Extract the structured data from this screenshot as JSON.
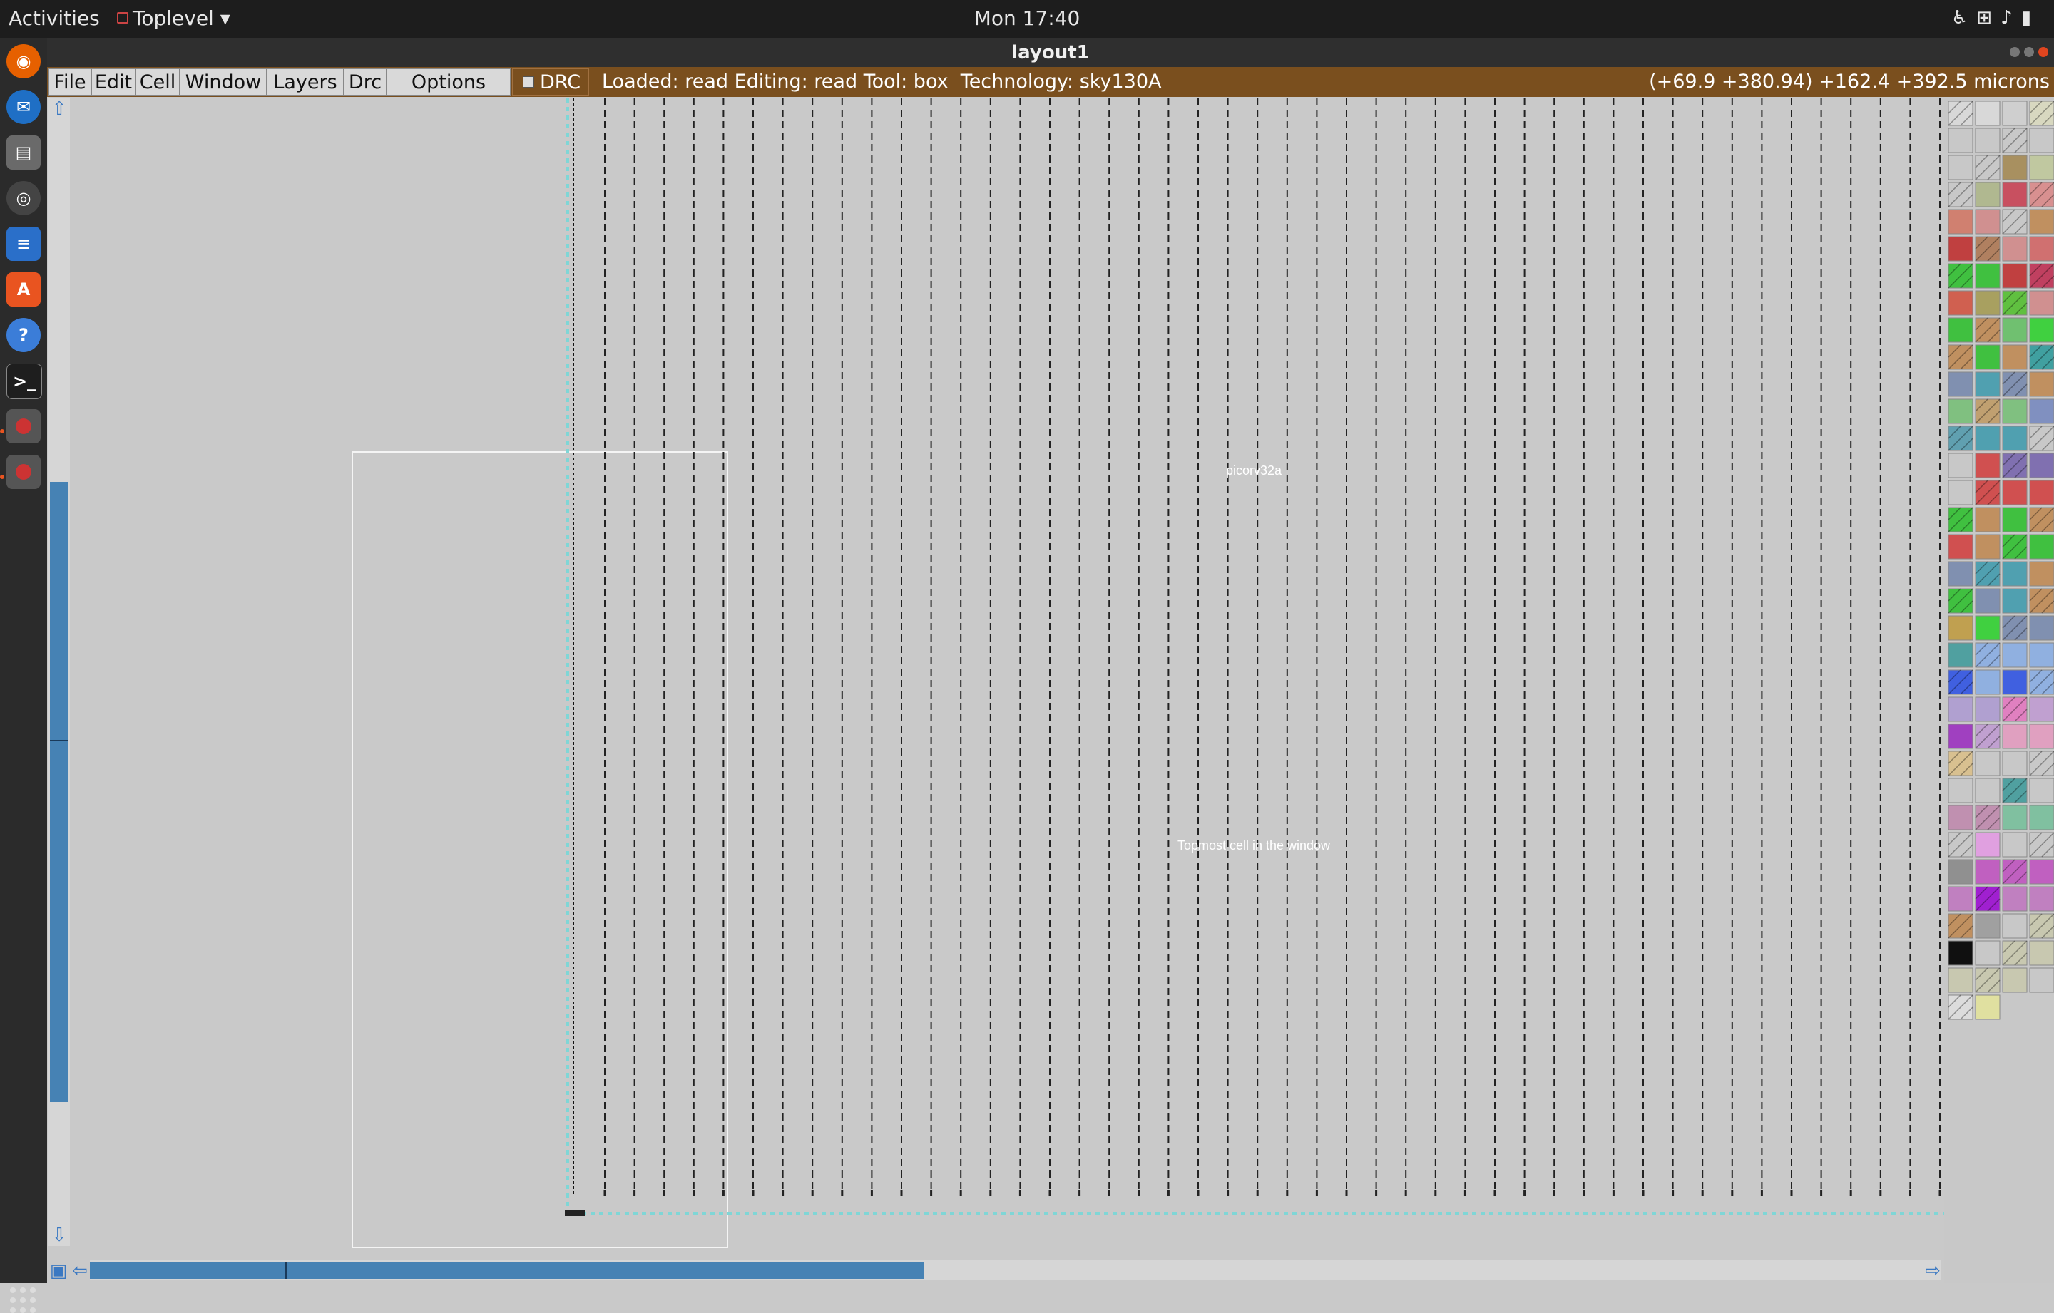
{
  "topbar": {
    "activities": "Activities",
    "app_menu": "Toplevel",
    "clock": "Mon 17:40",
    "tray_icons": [
      "accessibility-icon",
      "network-icon",
      "volume-icon",
      "battery-icon"
    ]
  },
  "dock": {
    "items": [
      "firefox-icon",
      "thunderbird-icon",
      "files-icon",
      "rhythmbox-icon",
      "writer-icon",
      "software-icon",
      "help-icon",
      "terminal-icon",
      "magic-icon",
      "magic-icon"
    ]
  },
  "window": {
    "title": "layout1"
  },
  "menubar": {
    "menus": [
      "File",
      "Edit",
      "Cell",
      "Window",
      "Layers",
      "Drc",
      "Options"
    ],
    "drc_label": "DRC",
    "status": "Loaded: read Editing: read Tool: box  Technology: sky130A",
    "coords": "(+69.9 +380.94) +162.4 +392.5 microns"
  },
  "layout": {
    "cell_label": "picorv32a",
    "window_label": "Topmost cell in the window"
  },
  "colors": {
    "menubar": "#7a4f1e",
    "scroll_thumb": "#4682b4",
    "canvas": "#c9c9c9"
  },
  "palette_colors": [
    "#d8d8d8",
    "#d8d8d8",
    "#cfcfcf",
    "#d8d8c0",
    "#c8c8c8",
    "#c8c8c8",
    "#c8c8c8",
    "#c8c8c8",
    "#c8c8c8",
    "#c8c8c8",
    "#a89060",
    "#c0c8a0",
    "#c8c8c8",
    "#b0b890",
    "#c85060",
    "#d89090",
    "#d08070",
    "#d09090",
    "#c8c8c8",
    "#c09060",
    "#c04040",
    "#b08060",
    "#d09090",
    "#d07070",
    "#40c040",
    "#40c040",
    "#c04040",
    "#c04060",
    "#d06050",
    "#a8a060",
    "#60c040",
    "#d09090",
    "#40c040",
    "#c09060",
    "#70c070",
    "#40d040",
    "#c09060",
    "#40c040",
    "#c09060",
    "#40a0a0",
    "#8090b0",
    "#50a0b0",
    "#8090b0",
    "#c09060",
    "#80c080",
    "#c0a070",
    "#80c080",
    "#8090c0",
    "#60a0b0",
    "#50a0b0",
    "#50a0b0",
    "#c8c8c8",
    "#c8c8c8",
    "#d05050",
    "#8070b0",
    "#8070b0",
    "#c8c8c8",
    "#d05050",
    "#d05050",
    "#d05050",
    "#40c040",
    "#c09060",
    "#40c040",
    "#c09060",
    "#d05050",
    "#c09060",
    "#40c040",
    "#40c040",
    "#8090b0",
    "#50a0b0",
    "#50a0b0",
    "#c09060",
    "#40c040",
    "#8090b0",
    "#50a0b0",
    "#c09060",
    "#c0a050",
    "#40d040",
    "#8090b0",
    "#8090b0",
    "#50a0a0",
    "#90b0e0",
    "#90b0e0",
    "#90b0e0",
    "#4060e0",
    "#90b0e0",
    "#4060e0",
    "#90b0e0",
    "#b0a0d0",
    "#b0a0d0",
    "#e080c0",
    "#c0a0d0",
    "#a040c0",
    "#c0a0d0",
    "#e0a0c0",
    "#e0a0c0",
    "#d8c090",
    "#c8c8c8",
    "#c8c8c8",
    "#c8c8c8",
    "#c8c8c8",
    "#c8c8c8",
    "#50a0a0",
    "#c8c8c8",
    "#c090b0",
    "#c090b0",
    "#80c0a0",
    "#80c0a0",
    "#c8c8c8",
    "#e0a0e0",
    "#c8c8c8",
    "#c8c8c8",
    "#909090",
    "#c060c0",
    "#c060c0",
    "#c060c0",
    "#c080c0",
    "#a020d0",
    "#c080c0",
    "#c080c0",
    "#c09060",
    "#a0a0a0",
    "#c8c8c8",
    "#c8c8b0",
    "#101010",
    "#c8c8c8",
    "#c8c8b0",
    "#c8c8b0",
    "#c8c8b0",
    "#c8c8b0",
    "#c8c8b0",
    "#c8c8c8",
    "#dcdcdc",
    "#e0e0a0"
  ]
}
